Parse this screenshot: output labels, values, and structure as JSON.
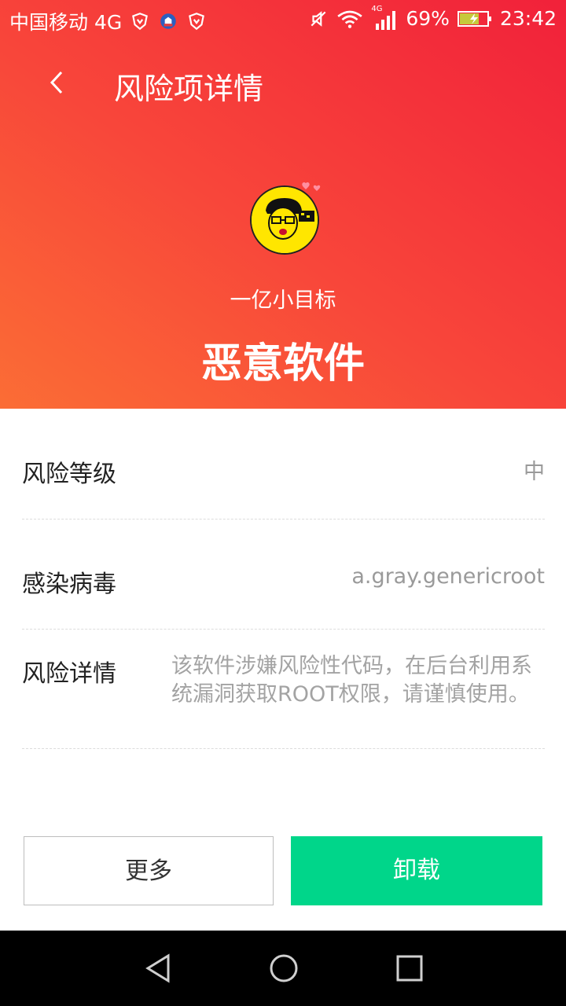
{
  "status_bar": {
    "carrier": "中国移动 4G",
    "network_small": "4G",
    "battery": "69%",
    "time": "23:42"
  },
  "header": {
    "title": "风险项详情",
    "app_name": "一亿小目标",
    "risk_type": "恶意软件"
  },
  "details": {
    "risk_level_label": "风险等级",
    "risk_level_value": "中",
    "virus_label": "感染病毒",
    "virus_value": "a.gray.genericroot",
    "risk_detail_label": "风险详情",
    "risk_detail_value": "该软件涉嫌风险性代码，在后台利用系统漏洞获取ROOT权限，请谨慎使用。"
  },
  "actions": {
    "more_label": "更多",
    "uninstall_label": "卸载"
  },
  "colors": {
    "header_gradient_start": "#fb6d35",
    "header_gradient_end": "#f1213a",
    "uninstall_button": "#00d68a"
  }
}
